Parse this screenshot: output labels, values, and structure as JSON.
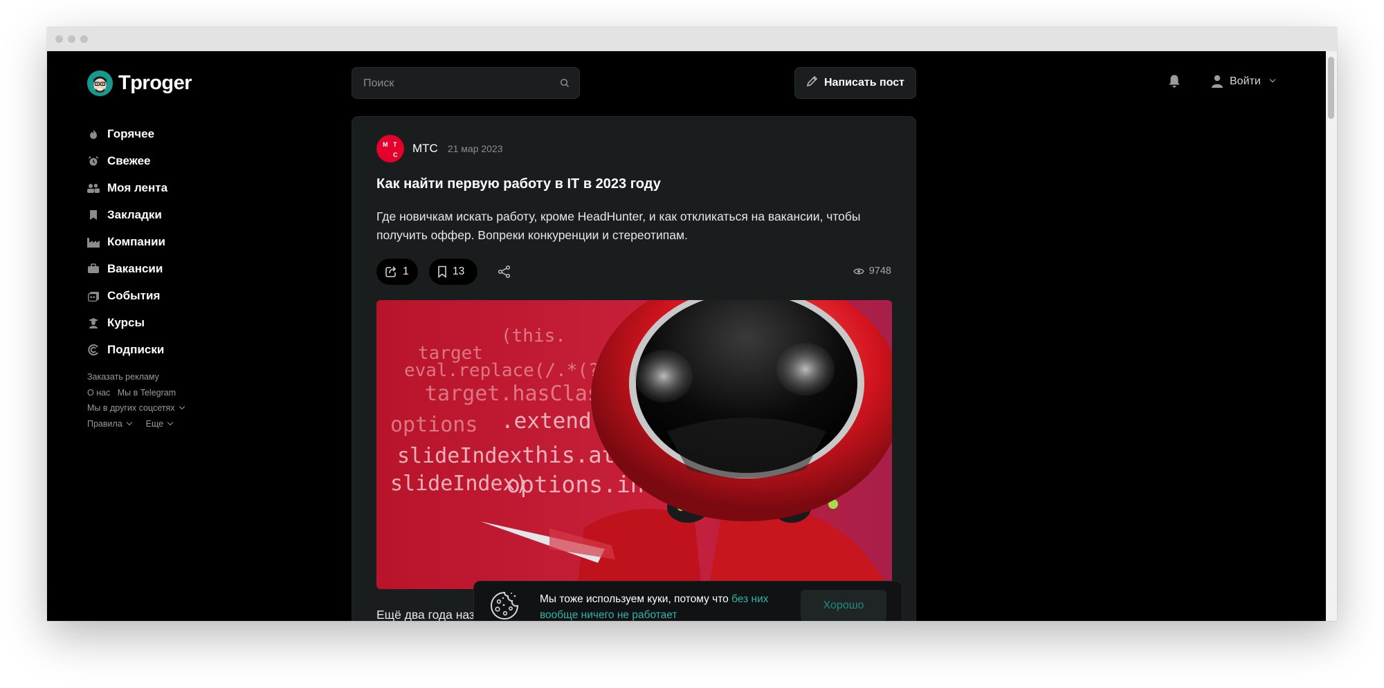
{
  "site": {
    "name": "Tproger"
  },
  "nav": {
    "items": [
      {
        "label": "Горячее",
        "icon": "fire-icon"
      },
      {
        "label": "Свежее",
        "icon": "alarm-clock-icon"
      },
      {
        "label": "Моя лента",
        "icon": "people-icon"
      },
      {
        "label": "Закладки",
        "icon": "bookmark-icon"
      },
      {
        "label": "Компании",
        "icon": "factory-icon"
      },
      {
        "label": "Вакансии",
        "icon": "briefcase-icon"
      },
      {
        "label": "События",
        "icon": "calendar-icon"
      },
      {
        "label": "Курсы",
        "icon": "graduation-icon"
      },
      {
        "label": "Подписки",
        "icon": "subscriptions-icon"
      }
    ]
  },
  "footer": {
    "ads": "Заказать рекламу",
    "about": "О нас",
    "telegram": "Мы в Telegram",
    "socials": "Мы в других соцсетях",
    "rules": "Правила",
    "more": "Еще"
  },
  "header": {
    "search_placeholder": "Поиск",
    "write_post": "Написать пост",
    "login": "Войти"
  },
  "post": {
    "author": "МТС",
    "logo_letters": {
      "m": "М",
      "t": "Т",
      "s": "С"
    },
    "date": "21 мар 2023",
    "title": "Как найти первую работу в IT в 2023 году",
    "excerpt": "Где новичкам искать работу, кроме HeadHunter, и как откликаться на вакансии, чтобы получить оффер. Вопреки конкуренции и стереотипам.",
    "reposts": "1",
    "bookmarks": "13",
    "views": "9748",
    "image_code": [
      "(this.",
      "target",
      "eval.replace(/.*(?=",
      "target.hasClass(",
      "options",
      ".extend({",
      "slideIndex",
      "this.attr",
      "slideIndex)",
      "options.interv"
    ],
    "body_start": "Ещё два года назад спрос на айтишников превышал предложение, и на мало-"
  },
  "cookie": {
    "text": "Мы тоже используем куки, потому что ",
    "link": "без них вообще ничего не работает",
    "button": "Хорошо"
  },
  "colors": {
    "background": "#000000",
    "card": "#1a1d1e",
    "accent": "#2fb3a7",
    "mts_red": "#e3002c"
  }
}
